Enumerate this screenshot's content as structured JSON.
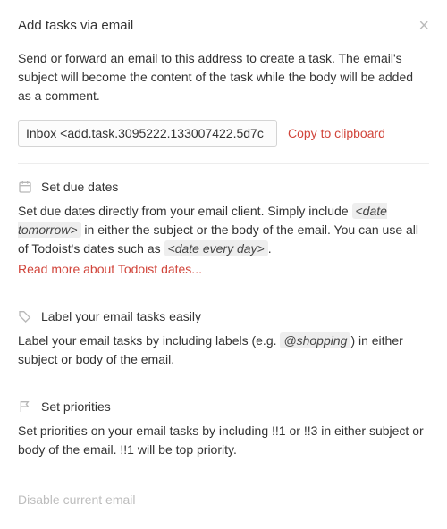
{
  "header": {
    "title": "Add tasks via email"
  },
  "intro": "Send or forward an email to this address to create a task. The email's subject will become the content of the task while the body will be added as a comment.",
  "email": {
    "value": "Inbox <add.task.3095222.133007422.5d7c",
    "copy_label": "Copy to clipboard"
  },
  "sections": {
    "due_dates": {
      "title": "Set due dates",
      "body_pre": "Set due dates directly from your email client. Simply include ",
      "tag1": "<date tomorrow>",
      "body_mid": " in either the subject or the body of the email. You can use all of Todoist's dates such as ",
      "tag2": "<date every day>",
      "body_post": ".",
      "read_more": "Read more about Todoist dates..."
    },
    "labels": {
      "title": "Label your email tasks easily",
      "body_pre": "Label your email tasks by including labels (e.g. ",
      "tag": "@shopping",
      "body_post": ") in either subject or body of the email."
    },
    "priorities": {
      "title": "Set priorities",
      "body": "Set priorities on your email tasks by including !!1 or !!3 in either subject or body of the email. !!1 will be top priority."
    }
  },
  "footer": {
    "disable": "Disable current email"
  }
}
